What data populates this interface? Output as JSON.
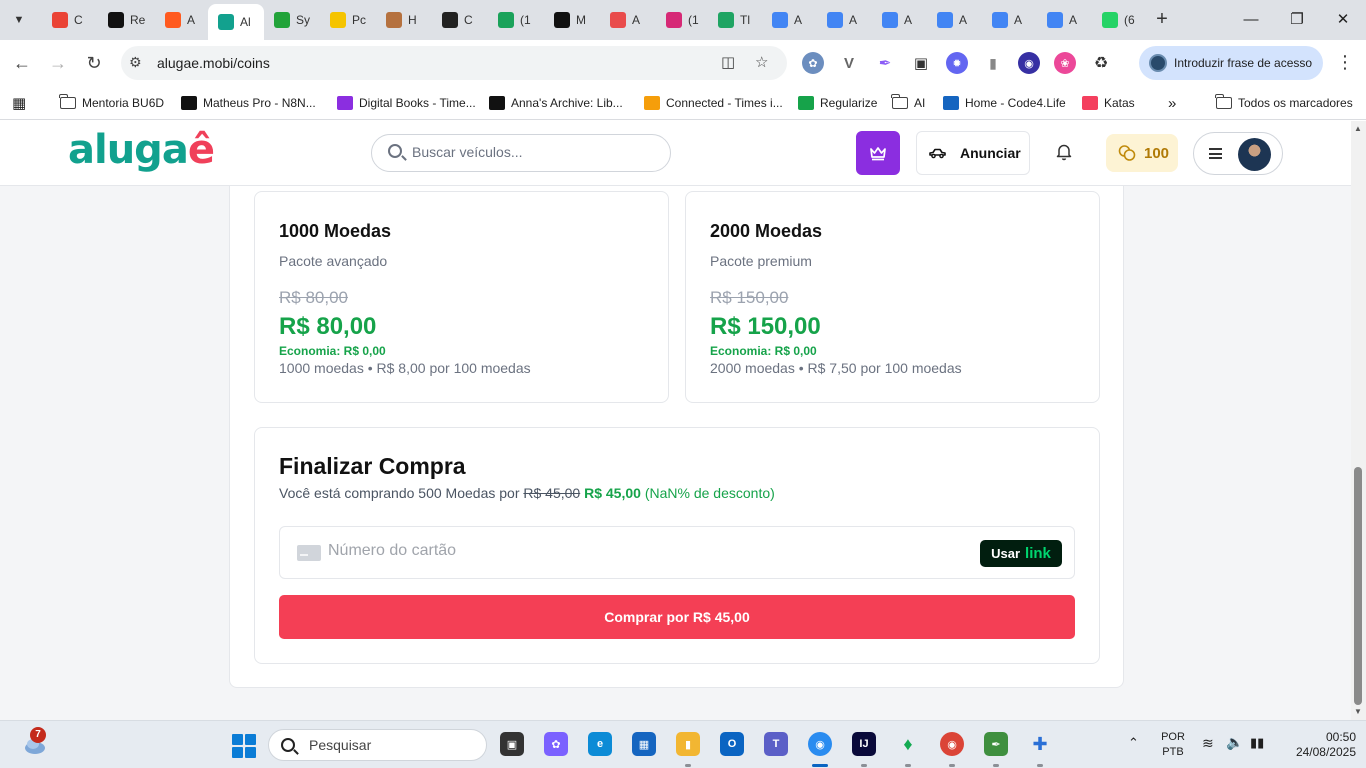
{
  "browser": {
    "tabs": [
      {
        "label": "C",
        "icon": "gmail-icon",
        "color": "#ea4335"
      },
      {
        "label": "Re",
        "icon": "r-app-icon",
        "color": "#111111"
      },
      {
        "label": "A",
        "icon": "zapier-like-icon",
        "color": "#ff5a1f"
      },
      {
        "label": "Al",
        "icon": "alugae-icon",
        "color": "#12a18e",
        "active": true
      },
      {
        "label": "Sy",
        "icon": "green-globe-icon",
        "color": "#22a33a"
      },
      {
        "label": "Pc",
        "icon": "m-app-icon",
        "color": "#f5c400"
      },
      {
        "label": "H",
        "icon": "box-icon",
        "color": "#b5713f"
      },
      {
        "label": "C",
        "icon": "z-app-icon",
        "color": "#222222"
      },
      {
        "label": "(1",
        "icon": "diamond-icon",
        "color": "#1aa25a"
      },
      {
        "label": "M",
        "icon": "n8n-icon",
        "color": "#111111"
      },
      {
        "label": "A",
        "icon": "person-icon",
        "color": "#e94c4c"
      },
      {
        "label": "(1",
        "icon": "instagram-icon",
        "color": "#d62976"
      },
      {
        "label": "Tl",
        "icon": "drive-icon",
        "color": "#1fa463"
      },
      {
        "label": "A",
        "icon": "docs-icon",
        "color": "#4285f4"
      },
      {
        "label": "A",
        "icon": "docs-icon",
        "color": "#4285f4"
      },
      {
        "label": "A",
        "icon": "docs-icon",
        "color": "#4285f4"
      },
      {
        "label": "A",
        "icon": "docs-icon",
        "color": "#4285f4"
      },
      {
        "label": "A",
        "icon": "docs-icon",
        "color": "#4285f4"
      },
      {
        "label": "A",
        "icon": "docs-icon",
        "color": "#4285f4"
      },
      {
        "label": "(6",
        "icon": "whatsapp-icon",
        "color": "#25d366"
      }
    ],
    "url": "alugae.mobi/coins",
    "passphrase_label": "Introduzir frase de acesso",
    "bookmarks": [
      {
        "label": "Mentoria BU6D",
        "icon": "folder-icon"
      },
      {
        "label": "Matheus Pro - N8N...",
        "icon": "n8n-icon"
      },
      {
        "label": "Digital Books - Time...",
        "icon": "book-icon"
      },
      {
        "label": "Anna's Archive: Lib...",
        "icon": "anna-icon"
      },
      {
        "label": "Connected - Times i...",
        "icon": "connected-icon"
      },
      {
        "label": "Regularize",
        "icon": "regularize-icon"
      },
      {
        "label": "AI",
        "icon": "folder-icon"
      },
      {
        "label": "Home - Code4.Life",
        "icon": "code4life-icon"
      },
      {
        "label": "Katas",
        "icon": "katas-icon"
      }
    ],
    "all_bookmarks_label": "Todos os marcadores"
  },
  "header": {
    "logo_part1": "aluga",
    "logo_part2": "ê",
    "search_placeholder": "Buscar veículos...",
    "anunciar_label": "Anunciar",
    "coins_count": "100"
  },
  "packages": [
    {
      "title": "1000 Moedas",
      "subtitle": "Pacote avançado",
      "old_price": "R$ 80,00",
      "new_price": "R$ 80,00",
      "savings": "Economia: R$ 0,00",
      "info": "1000 moedas • R$ 8,00 por 100 moedas"
    },
    {
      "title": "2000 Moedas",
      "subtitle": "Pacote premium",
      "old_price": "R$ 150,00",
      "new_price": "R$ 150,00",
      "savings": "Economia: R$ 0,00",
      "info": "2000 moedas • R$ 7,50 por 100 moedas"
    }
  ],
  "checkout": {
    "title": "Finalizar Compra",
    "summary_prefix": "Você está comprando 500 Moedas por",
    "old_price": "R$ 45,00",
    "new_price": "R$ 45,00",
    "discount": "(NaN% de desconto)",
    "card_placeholder": "Número do cartão",
    "link_prefix": "Usar",
    "link_word": "link",
    "buy_label": "Comprar por R$ 45,00"
  },
  "taskbar": {
    "weather_badge": "7",
    "search_placeholder": "Pesquisar",
    "lang_line1": "POR",
    "lang_line2": "PTB",
    "time": "00:50",
    "date": "24/08/2025"
  }
}
